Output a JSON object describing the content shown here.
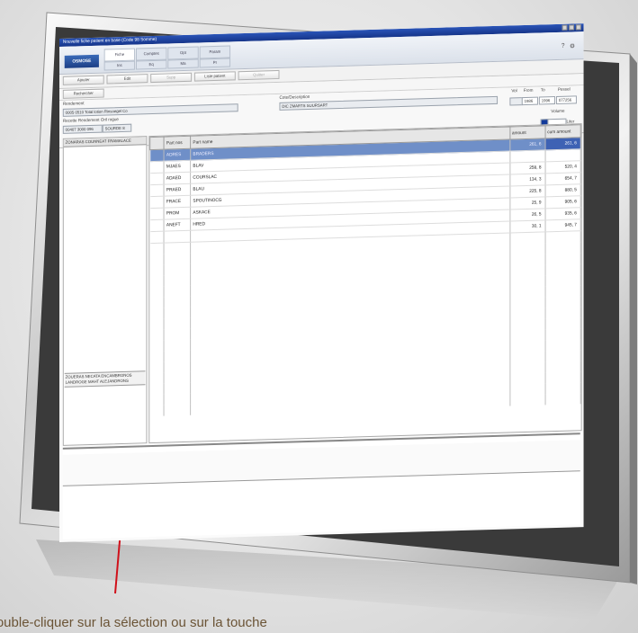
{
  "window": {
    "title": "Nouvelle fiche patient en base (Code 98 Somme)"
  },
  "ribbon": {
    "brand": "OSMOSE",
    "tabs": [
      "Fiche",
      "Comptes",
      "Opt",
      "Param"
    ],
    "subtabs": [
      "Ins",
      "Eq",
      "Ma",
      "Pr"
    ]
  },
  "toolbar": {
    "buttons": [
      "Ajouter",
      "Edit",
      "Supp",
      "Liste patient",
      "Quitter"
    ],
    "second": "Rechercher"
  },
  "form": {
    "lbl_a": "Rendement",
    "val_a": "0005 0510 Total lotion Rinsoegel Co",
    "lbl_b": "Cote/Description",
    "val_b": "DIC ZMARTS SUURSART",
    "lbl_c": "Recette Rendement Oril rogue",
    "val_c1": "00407 3000 096",
    "val_c2": "SOURDE 8",
    "lbl_vol_hdr": "Vol",
    "lbl_from": "From",
    "lbl_to": "To",
    "lbl_pessel": "Pessel",
    "v_from": "1986",
    "v_to": "1996",
    "v_pessel": "077256",
    "lbl_volume": "Volume",
    "lbl_liter": "Liter"
  },
  "left": {
    "header": "ZONARAS COUNNEAT FRAMALACE",
    "note": "ZOUERAS NECATA ENCAMBRONOS LANDROGE MAHT ALEJANDRONS"
  },
  "grid": {
    "columns": [
      "Part nos",
      "Part name",
      "amount",
      "cum amount"
    ],
    "rows": [
      {
        "code": "ADRES",
        "name": "BRADERS",
        "amount": "261, 6",
        "cum": "261, 6",
        "selected": true
      },
      {
        "code": "MJAES",
        "name": "BLAV",
        "amount": "",
        "cum": "",
        "selected": false
      },
      {
        "code": "ADAED",
        "name": "COURSLAC",
        "amount": "258, 8",
        "cum": "520, 4",
        "selected": false
      },
      {
        "code": "PRAED",
        "name": "BLAU",
        "amount": "134, 3",
        "cum": "654, 7",
        "selected": false
      },
      {
        "code": "FRACE",
        "name": "SPOUTINOCG",
        "amount": "225, 8",
        "cum": "880, 5",
        "selected": false
      },
      {
        "code": "PROM",
        "name": "ASKACE",
        "amount": "25, 9",
        "cum": "905, 6",
        "selected": false
      },
      {
        "code": "ANEFT",
        "name": "HRED",
        "amount": "26, 5",
        "cum": "935, 6",
        "selected": false
      },
      {
        "code": "",
        "name": "",
        "amount": "30, 1",
        "cum": "945, 7",
        "selected": false
      }
    ]
  },
  "caption": "Double-cliquer sur la sélection ou sur la touche"
}
